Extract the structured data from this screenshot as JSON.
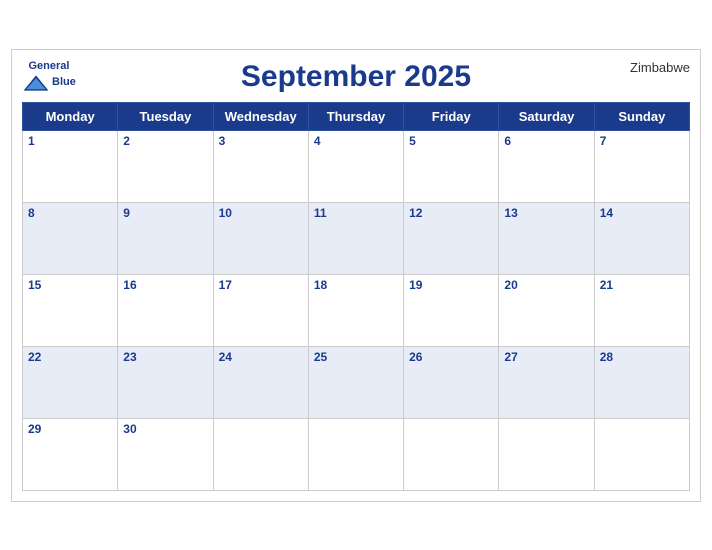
{
  "header": {
    "title": "September 2025",
    "country": "Zimbabwe",
    "logo": {
      "line1": "General",
      "line2": "Blue"
    }
  },
  "weekdays": [
    "Monday",
    "Tuesday",
    "Wednesday",
    "Thursday",
    "Friday",
    "Saturday",
    "Sunday"
  ],
  "weeks": [
    [
      {
        "date": 1,
        "empty": false
      },
      {
        "date": 2,
        "empty": false
      },
      {
        "date": 3,
        "empty": false
      },
      {
        "date": 4,
        "empty": false
      },
      {
        "date": 5,
        "empty": false
      },
      {
        "date": 6,
        "empty": false
      },
      {
        "date": 7,
        "empty": false
      }
    ],
    [
      {
        "date": 8,
        "empty": false
      },
      {
        "date": 9,
        "empty": false
      },
      {
        "date": 10,
        "empty": false
      },
      {
        "date": 11,
        "empty": false
      },
      {
        "date": 12,
        "empty": false
      },
      {
        "date": 13,
        "empty": false
      },
      {
        "date": 14,
        "empty": false
      }
    ],
    [
      {
        "date": 15,
        "empty": false
      },
      {
        "date": 16,
        "empty": false
      },
      {
        "date": 17,
        "empty": false
      },
      {
        "date": 18,
        "empty": false
      },
      {
        "date": 19,
        "empty": false
      },
      {
        "date": 20,
        "empty": false
      },
      {
        "date": 21,
        "empty": false
      }
    ],
    [
      {
        "date": 22,
        "empty": false
      },
      {
        "date": 23,
        "empty": false
      },
      {
        "date": 24,
        "empty": false
      },
      {
        "date": 25,
        "empty": false
      },
      {
        "date": 26,
        "empty": false
      },
      {
        "date": 27,
        "empty": false
      },
      {
        "date": 28,
        "empty": false
      }
    ],
    [
      {
        "date": 29,
        "empty": false
      },
      {
        "date": 30,
        "empty": false
      },
      {
        "date": null,
        "empty": true
      },
      {
        "date": null,
        "empty": true
      },
      {
        "date": null,
        "empty": true
      },
      {
        "date": null,
        "empty": true
      },
      {
        "date": null,
        "empty": true
      }
    ]
  ],
  "colors": {
    "header_bg": "#1a3a8c",
    "header_text": "#ffffff",
    "day_number": "#1a3a8c",
    "row_even_bg": "#e8ecf7",
    "row_odd_bg": "#ffffff"
  }
}
